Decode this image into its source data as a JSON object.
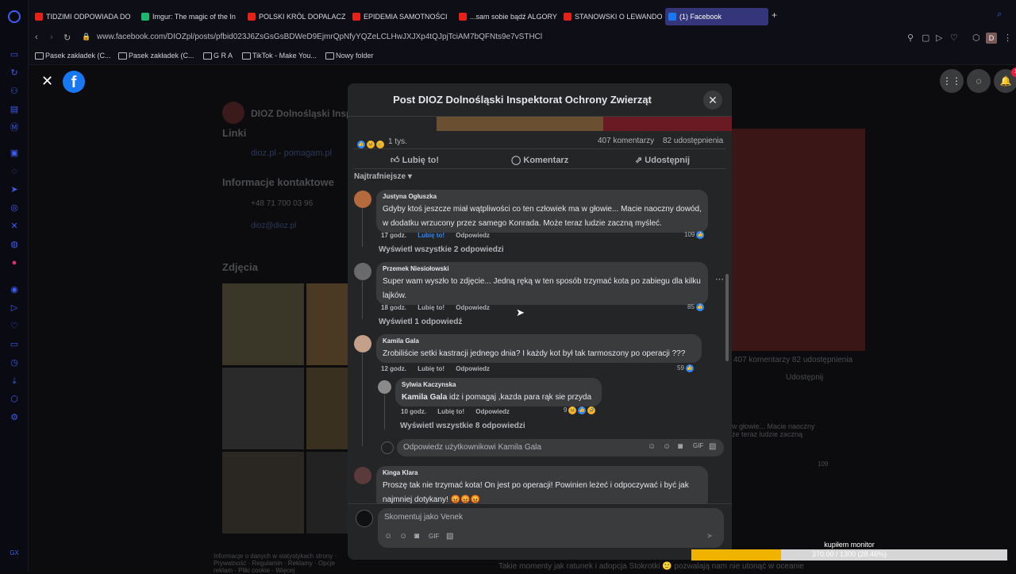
{
  "browser": {
    "tabs": [
      {
        "label": "TIDZIMI ODPOWIADA DO",
        "icon": "youtube-icon"
      },
      {
        "label": "Imgur: The magic of the In",
        "icon": "imgur-icon"
      },
      {
        "label": "POLSKI KRÓL DOPALACZ",
        "icon": "youtube-icon"
      },
      {
        "label": "EPIDEMIA SAMOTNOŚCI",
        "icon": "youtube-icon"
      },
      {
        "label": "...sam sobie bądź ALGORY",
        "icon": "youtube-icon"
      },
      {
        "label": "STANOWSKI O LEWANDO",
        "icon": "youtube-icon"
      },
      {
        "label": "(1) Facebook",
        "icon": "facebook-icon"
      }
    ],
    "url": "www.facebook.com/DIOZpl/posts/pfbid023J6ZsGsGsBDWeD9EjmrQpNfyYQZeLCLHwJXJXp4tQJpjTciAM7bQFNts9e7vSTHCl",
    "bookmarks": [
      "Pasek zakładek (C...",
      "Pasek zakładek (C...",
      "G R A",
      "TikTok - Make You...",
      "Nowy folder"
    ],
    "profile_letter": "D"
  },
  "background_page": {
    "page_name": "DIOZ Dolnośląski Insp",
    "links_heading": "Linki",
    "link_text": "dioz.pl - pomagam.pl",
    "contact_heading": "Informacje kontaktowe",
    "phone": "+48 71 700 03 96",
    "email": "dioz@dioz.pl",
    "photos_heading": "Zdjęcia",
    "footer": "Informacje o danych w statystykach strony · Prywatność · Regulamin · Reklamy · Opcje reklam · Pliki cookie · Więcej",
    "bottom_caption": "Takie momenty jak ratunek i adopcja Stokrotki 🙂 pozwalają nam nie utonąć w oceanie",
    "right_counts": "407 komentarzy  82 udostępnienia",
    "right_share": "Udostępnij",
    "right_snippet": "w głowie... Macie naoczny\nże teraz ludzie zaczną",
    "right_likes": "109"
  },
  "modal": {
    "title": "Post DIOZ Dolnośląski Inspektorat Ochrony Zwierząt",
    "reactions_count": "1 tys.",
    "comments_count": "407 komentarzy",
    "shares_count": "82 udostępnienia",
    "like_label": "Lubię to!",
    "comment_label": "Komentarz",
    "share_label": "Udostępnij",
    "sort_label": "Najtrafniejsze",
    "comments": [
      {
        "name": "Justyna Ogłuszka",
        "text": "Gdyby ktoś jeszcze miał wątpliwości co ten człowiek ma w głowie... Macie naoczny dowód, w dodatku wrzucony przez samego Konrada. Może teraz ludzie zaczną myśleć.",
        "time": "17 godz.",
        "like": "Lubię to!",
        "reply": "Odpowiedz",
        "likes": "109",
        "more": "Wyświetl wszystkie 2 odpowiedzi"
      },
      {
        "name": "Przemek Niesiołowski",
        "text": "Super wam wyszło to zdjęcie... Jedną ręką w ten sposób trzymać kota po zabiegu dla kilku lajków.",
        "time": "18 godz.",
        "like": "Lubię to!",
        "reply": "Odpowiedz",
        "likes": "85",
        "more": "Wyświetl 1 odpowiedź"
      },
      {
        "name": "Kamila Gala",
        "text": "Zrobiliście setki kastracji jednego dnia? I każdy kot był tak tarmoszony po operacji ???",
        "time": "12 godz.",
        "like": "Lubię to!",
        "reply": "Odpowiedz",
        "likes": "59"
      },
      {
        "name": "Kinga Klara",
        "text": "Proszę tak nie trzymać kota! On jest po operacji! Powinien leżeć i odpoczywać i być jak najmniej dotykany! 😡😡😡"
      }
    ],
    "reply": {
      "name": "Sylwia Kaczynska",
      "mention": "Kamila Gala",
      "text": "idz i pomagaj ,kazda para rąk sie przyda",
      "time": "10 godz.",
      "like": "Lubię to!",
      "reply": "Odpowiedz",
      "likes": "9",
      "more": "Wyświetl wszystkie 8 odpowiedzi"
    },
    "reply_placeholder": "Odpowiedz użytkownikowi Kamila Gala",
    "comment_placeholder": "Skomentuj jako Venek"
  },
  "overlay": {
    "goal_title": "kupiłem monitor",
    "goal_text": "370.00 / 1300 (28.46%)",
    "goal_progress": 0.2846
  },
  "notification_count": "1"
}
